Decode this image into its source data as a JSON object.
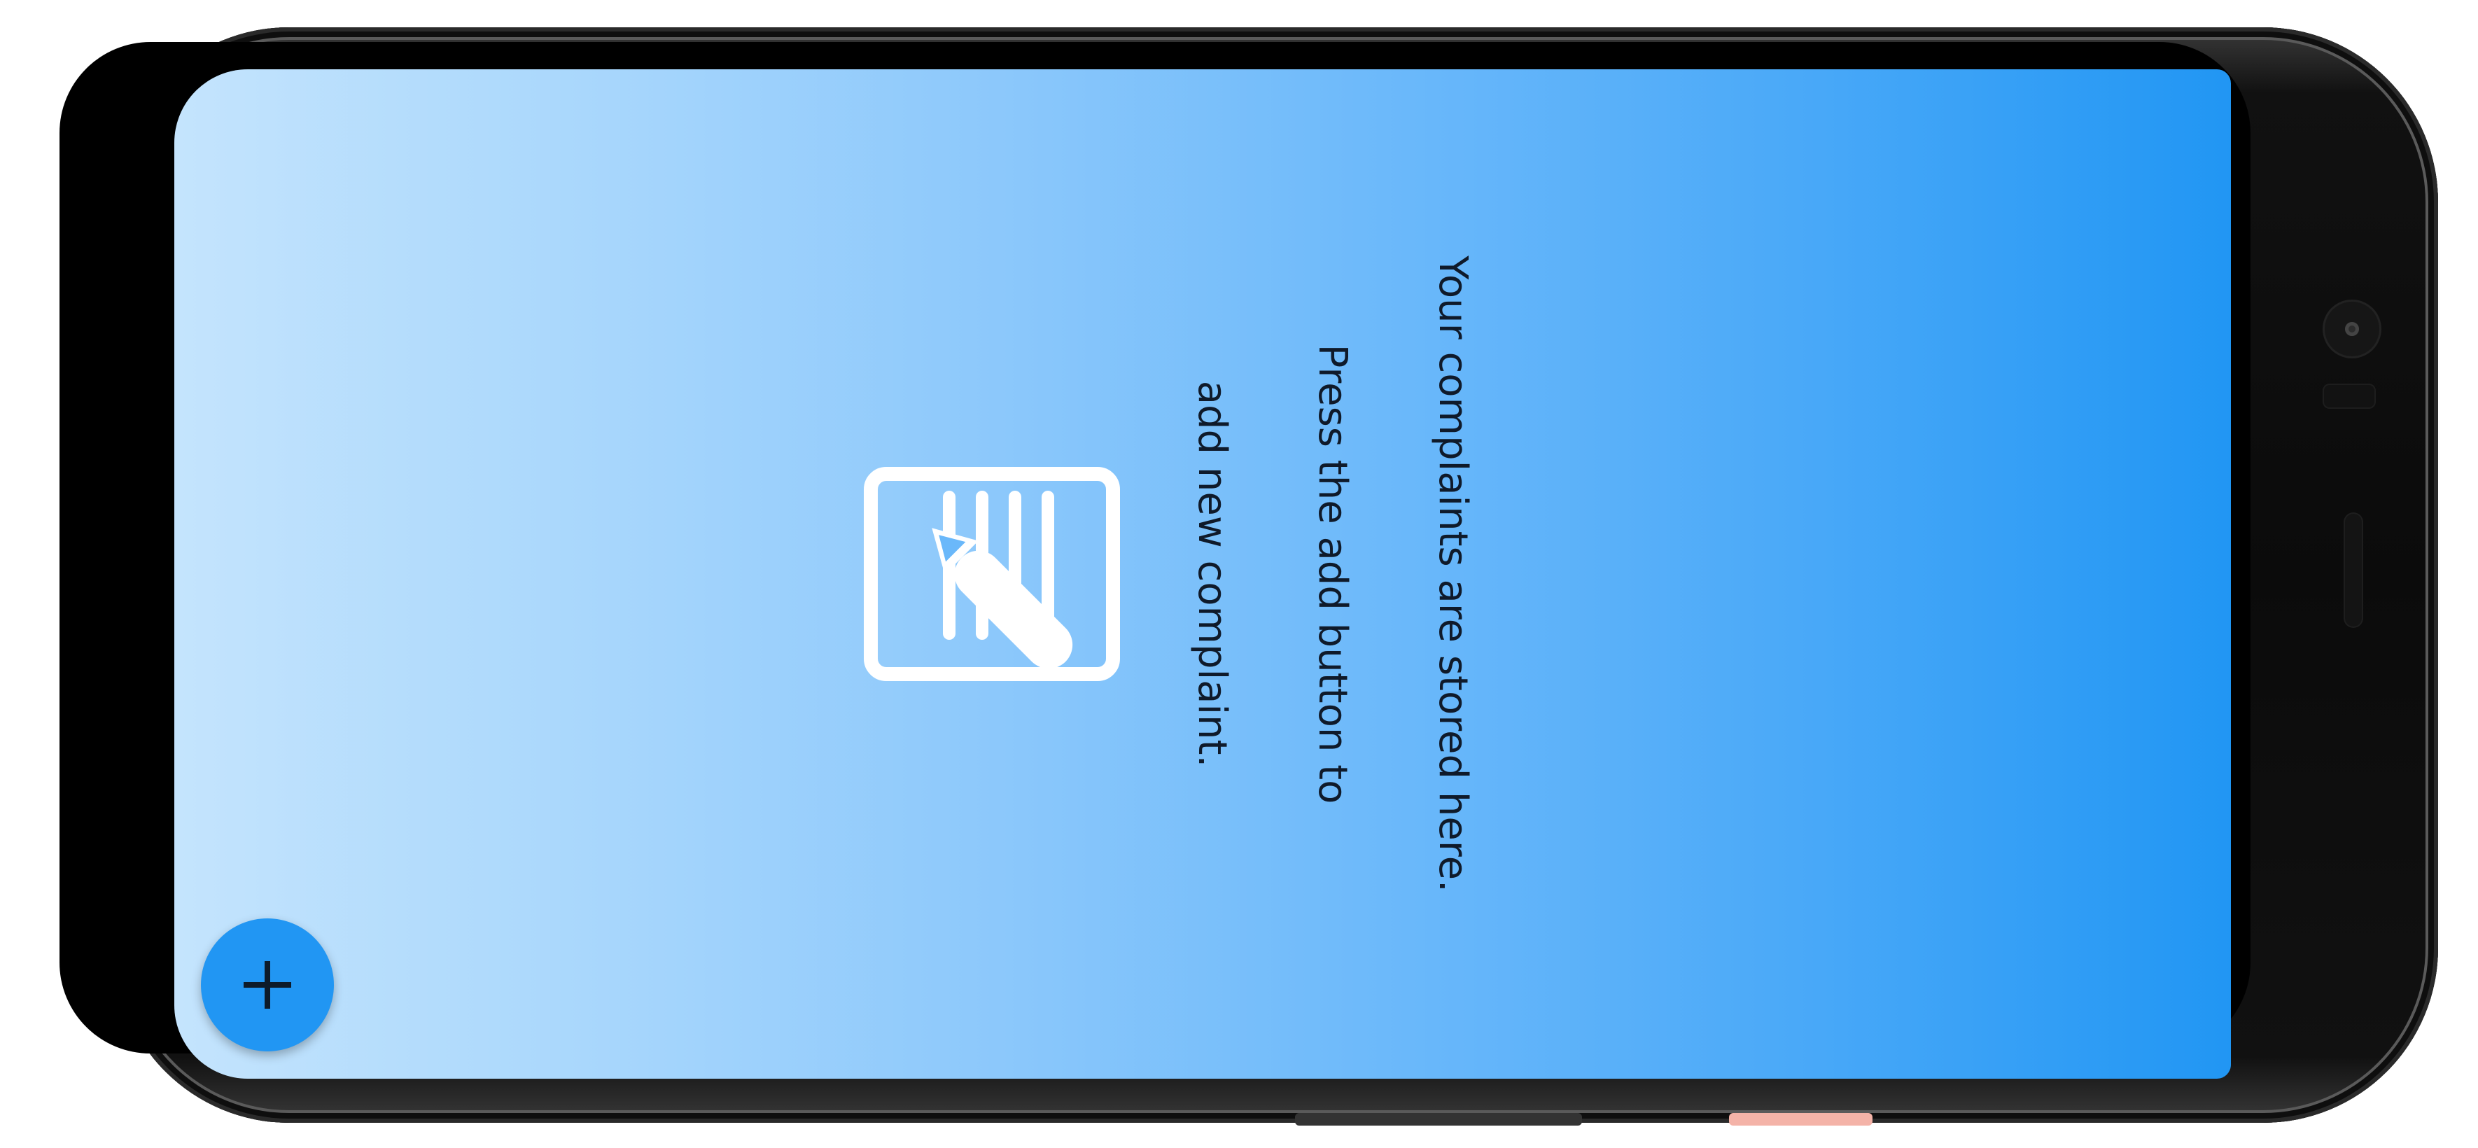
{
  "empty_state": {
    "icon": "complaint-edit-icon",
    "text_lines": [
      "Your complaints are stored here.",
      "Press the add button to",
      "add new complaint."
    ]
  },
  "fab": {
    "icon": "plus-icon",
    "color": "#2196f3"
  },
  "colors": {
    "gradient_start": "#c4e4fd",
    "gradient_end": "#2196f3",
    "text": "#0f1a2a"
  }
}
